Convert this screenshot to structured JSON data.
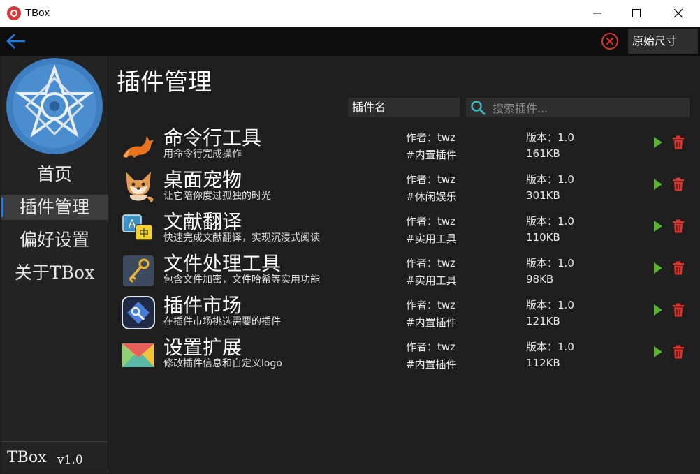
{
  "window": {
    "title": "TBox",
    "minimize": "—",
    "maximize": "☐",
    "close": "✕"
  },
  "toolbar": {
    "size_button": "原始尺寸"
  },
  "sidebar": {
    "items": [
      {
        "label": "首页",
        "active": false
      },
      {
        "label": "插件管理",
        "active": true
      },
      {
        "label": "偏好设置",
        "active": false
      },
      {
        "label": "关于TBox",
        "active": false
      }
    ],
    "footer": {
      "name": "TBox",
      "version": "v1.0"
    }
  },
  "main": {
    "title": "插件管理",
    "filter": {
      "selected": "插件名"
    },
    "search": {
      "placeholder": "搜索插件..."
    },
    "author_label": "作者：",
    "version_label": "版本：",
    "plugins": [
      {
        "name": "命令行工具",
        "desc": "用命令行完成操作",
        "author": "twz",
        "tag": "#内置插件",
        "version": "1.0",
        "size": "161KB",
        "icon": "fox-icon"
      },
      {
        "name": "桌面宠物",
        "desc": "让它陪你度过孤独的时光",
        "author": "twz",
        "tag": "#休闲娱乐",
        "version": "1.0",
        "size": "301KB",
        "icon": "pet-fox-icon"
      },
      {
        "name": "文献翻译",
        "desc": "快速完成文献翻译，实现沉浸式阅读",
        "author": "twz",
        "tag": "#实用工具",
        "version": "1.0",
        "size": "110KB",
        "icon": "translate-icon"
      },
      {
        "name": "文件处理工具",
        "desc": "包含文件加密，文件哈希等实用功能",
        "author": "twz",
        "tag": "#实用工具",
        "version": "1.0",
        "size": "98KB",
        "icon": "key-icon"
      },
      {
        "name": "插件市场",
        "desc": "在插件市场挑选需要的插件",
        "author": "twz",
        "tag": "#内置插件",
        "version": "1.0",
        "size": "121KB",
        "icon": "market-icon"
      },
      {
        "name": "设置扩展",
        "desc": "修改插件信息和自定义logo",
        "author": "twz",
        "tag": "#内置插件",
        "version": "1.0",
        "size": "112KB",
        "icon": "envelope-icon"
      }
    ]
  },
  "colors": {
    "accent": "#1e7be6",
    "play": "#5ab431",
    "delete": "#e0322d",
    "close_red": "#e0322d"
  }
}
